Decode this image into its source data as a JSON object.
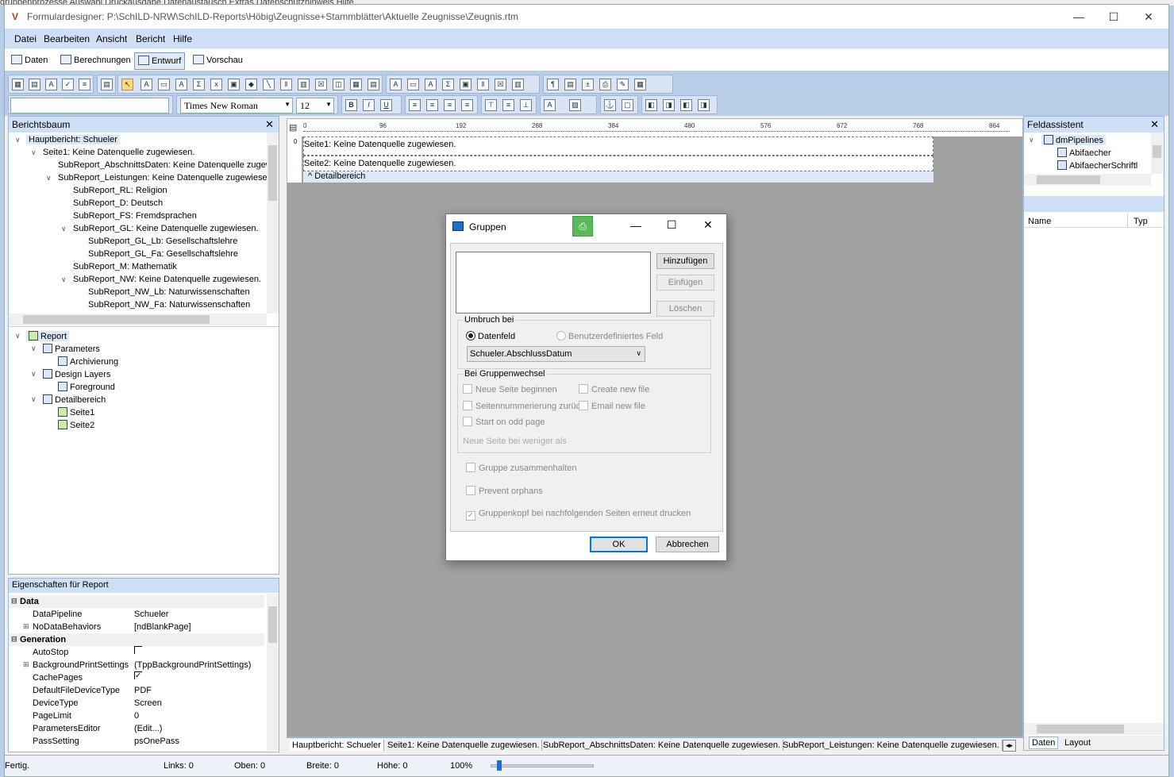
{
  "background_menu": {
    "text": "gruppenprozesse    Auswahl    Druckausgabe    Datenaustausch    Extras    Datenschutzhinweis    Hilfe"
  },
  "window": {
    "title": "Formulardesigner: P:\\SchILD-NRW\\SchILD-Reports\\Höbig\\Zeugnisse+Stammblätter\\Aktuelle Zeugnisse\\Zeugnis.rtm",
    "minimize": "—",
    "maximize": "☐",
    "close": "✕"
  },
  "menu": {
    "datei": "Datei",
    "bearbeiten": "Bearbeiten",
    "ansicht": "Ansicht",
    "bericht": "Bericht",
    "hilfe": "Hilfe"
  },
  "tabs": {
    "daten": "Daten",
    "berechnungen": "Berechnungen",
    "entwurf": "Entwurf",
    "vorschau": "Vorschau",
    "active": "Entwurf"
  },
  "toolbar": {
    "font_name": "Times New Roman",
    "font_size": "12"
  },
  "report_tree": {
    "title": "Berichtsbaum",
    "items": [
      "Hauptbericht: Schueler",
      "Seite1: Keine Datenquelle zugewiesen.",
      "SubReport_AbschnittsDaten: Keine Datenquelle zugew",
      "SubReport_Leistungen: Keine Datenquelle zugewiesen",
      "SubReport_RL: Religion",
      "SubReport_D: Deutsch",
      "SubReport_FS: Fremdsprachen",
      "SubReport_GL: Keine Datenquelle zugewiesen.",
      "SubReport_GL_Lb: Gesellschaftslehre",
      "SubReport_GL_Fa: Gesellschaftslehre",
      "SubReport_M: Mathematik",
      "SubReport_NW: Keine Datenquelle zugewiesen.",
      "SubReport_NW_Lb: Naturwissenschaften",
      "SubReport_NW_Fa: Naturwissenschaften"
    ]
  },
  "object_tree": {
    "items": [
      "Report",
      "Parameters",
      "Archivierung",
      "Design Layers",
      "Foreground",
      "Detailbereich",
      "Seite1",
      "Seite2"
    ]
  },
  "properties": {
    "title": "Eigenschaften für Report",
    "cat_data": "Data",
    "cat_generation": "Generation",
    "rows": [
      {
        "name": "DataPipeline",
        "value": "Schueler"
      },
      {
        "name": "NoDataBehaviors",
        "value": "[ndBlankPage]"
      },
      {
        "name": "AutoStop",
        "value": ""
      },
      {
        "name": "BackgroundPrintSettings",
        "value": "(TppBackgroundPrintSettings)"
      },
      {
        "name": "CachePages",
        "value": ""
      },
      {
        "name": "DefaultFileDeviceType",
        "value": "PDF"
      },
      {
        "name": "DeviceType",
        "value": "Screen"
      },
      {
        "name": "PageLimit",
        "value": "0"
      },
      {
        "name": "ParametersEditor",
        "value": "(Edit...)"
      },
      {
        "name": "PassSetting",
        "value": "psOnePass"
      }
    ],
    "cachepages_checked": true,
    "autostop_checked": false
  },
  "design": {
    "ruler_ticks": [
      "0",
      "96",
      "192",
      "288",
      "384",
      "480",
      "576",
      "672",
      "768",
      "864"
    ],
    "seite1": "Seite1: Keine Datenquelle zugewiesen.",
    "seite2": "Seite2: Keine Datenquelle zugewiesen.",
    "detail": "Detailbereich",
    "row0": "0"
  },
  "field_assistant": {
    "title": "Feldassistent",
    "root": "dmPipelines",
    "items": [
      "Abifaecher",
      "AbifaecherSchriftl"
    ],
    "col_name": "Name",
    "col_type": "Typ",
    "tab_daten": "Daten",
    "tab_layout": "Layout"
  },
  "dialog": {
    "title": "Gruppen",
    "btn_add": "Hinzufügen",
    "btn_insert": "Einfügen",
    "btn_delete": "Löschen",
    "group_break": "Umbruch bei",
    "radio_datafield": "Datenfeld",
    "radio_custom": "Benutzerdefiniertes Feld",
    "field_value": "Schueler.AbschlussDatum",
    "group_change": "Bei Gruppenwechsel",
    "cb_new_page": "Neue Seite beginnen",
    "cb_create_file": "Create new file",
    "cb_reset_pages": "Seitennummerierung zurück",
    "cb_email_file": "Email new file",
    "cb_odd_page": "Start on odd page",
    "new_page_less": "Neue Seite bei weniger als",
    "cb_keep_together": "Gruppe zusammenhalten",
    "cb_orphans": "Prevent orphans",
    "cb_reprint_header": "Gruppenkopf bei nachfolgenden Seiten erneut drucken",
    "ok": "OK",
    "cancel": "Abbrechen"
  },
  "bottom_tabs": [
    "Hauptbericht: Schueler",
    "Seite1: Keine Datenquelle zugewiesen.",
    "SubReport_AbschnittsDaten: Keine Datenquelle zugewiesen.",
    "SubReport_Leistungen: Keine Datenquelle zugewiesen."
  ],
  "status": {
    "ready": "Fertig.",
    "left": "Links: 0",
    "top": "Oben: 0",
    "width": "Breite: 0",
    "height": "Höhe: 0",
    "zoom": "100%"
  },
  "colors": {
    "panel_header": "#cfe0f6",
    "toolbar": "#b9cde9",
    "design_bg": "#a0a0a0",
    "accent": "#0078d7"
  }
}
